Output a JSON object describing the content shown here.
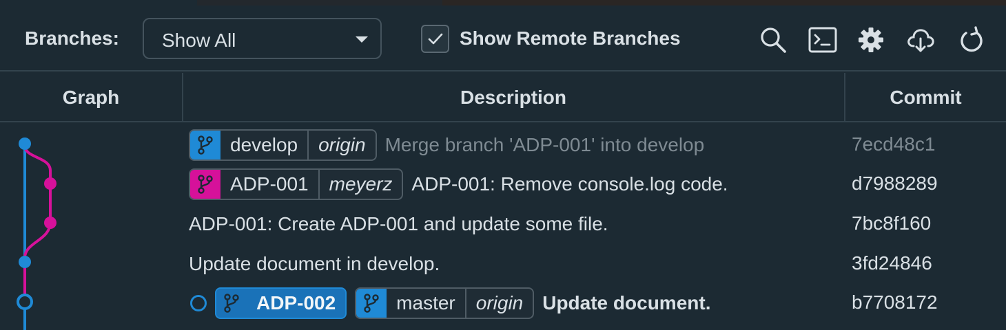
{
  "toolbar": {
    "branches_label": "Branches:",
    "branch_filter_value": "Show All",
    "show_remote_label": "Show Remote Branches",
    "show_remote_checked": true,
    "icons": [
      "search-icon",
      "terminal-icon",
      "gear-icon",
      "cloud-download-icon",
      "refresh-icon"
    ]
  },
  "columns": {
    "graph": "Graph",
    "description": "Description",
    "commit": "Commit"
  },
  "colors": {
    "background": "#1c2a33",
    "branch_blue": "#1f8ad6",
    "branch_pink": "#d6119a",
    "dim_text": "#7f8b93"
  },
  "rows": [
    {
      "branch": "develop",
      "remote": "origin",
      "message": "Merge branch 'ADP-001' into develop",
      "commit": "7ecd48c1"
    },
    {
      "branch": "ADP-001",
      "remote": "meyerz",
      "message": "ADP-001: Remove console.log code.",
      "commit": "d7988289"
    },
    {
      "message": "ADP-001: Create ADP-001 and update some file.",
      "commit": "7bc8f160"
    },
    {
      "message": "Update document in develop.",
      "commit": "3fd24846"
    },
    {
      "branch": "ADP-002",
      "branch2": "master",
      "remote2": "origin",
      "message": "Update document.",
      "commit": "b7708172"
    }
  ]
}
